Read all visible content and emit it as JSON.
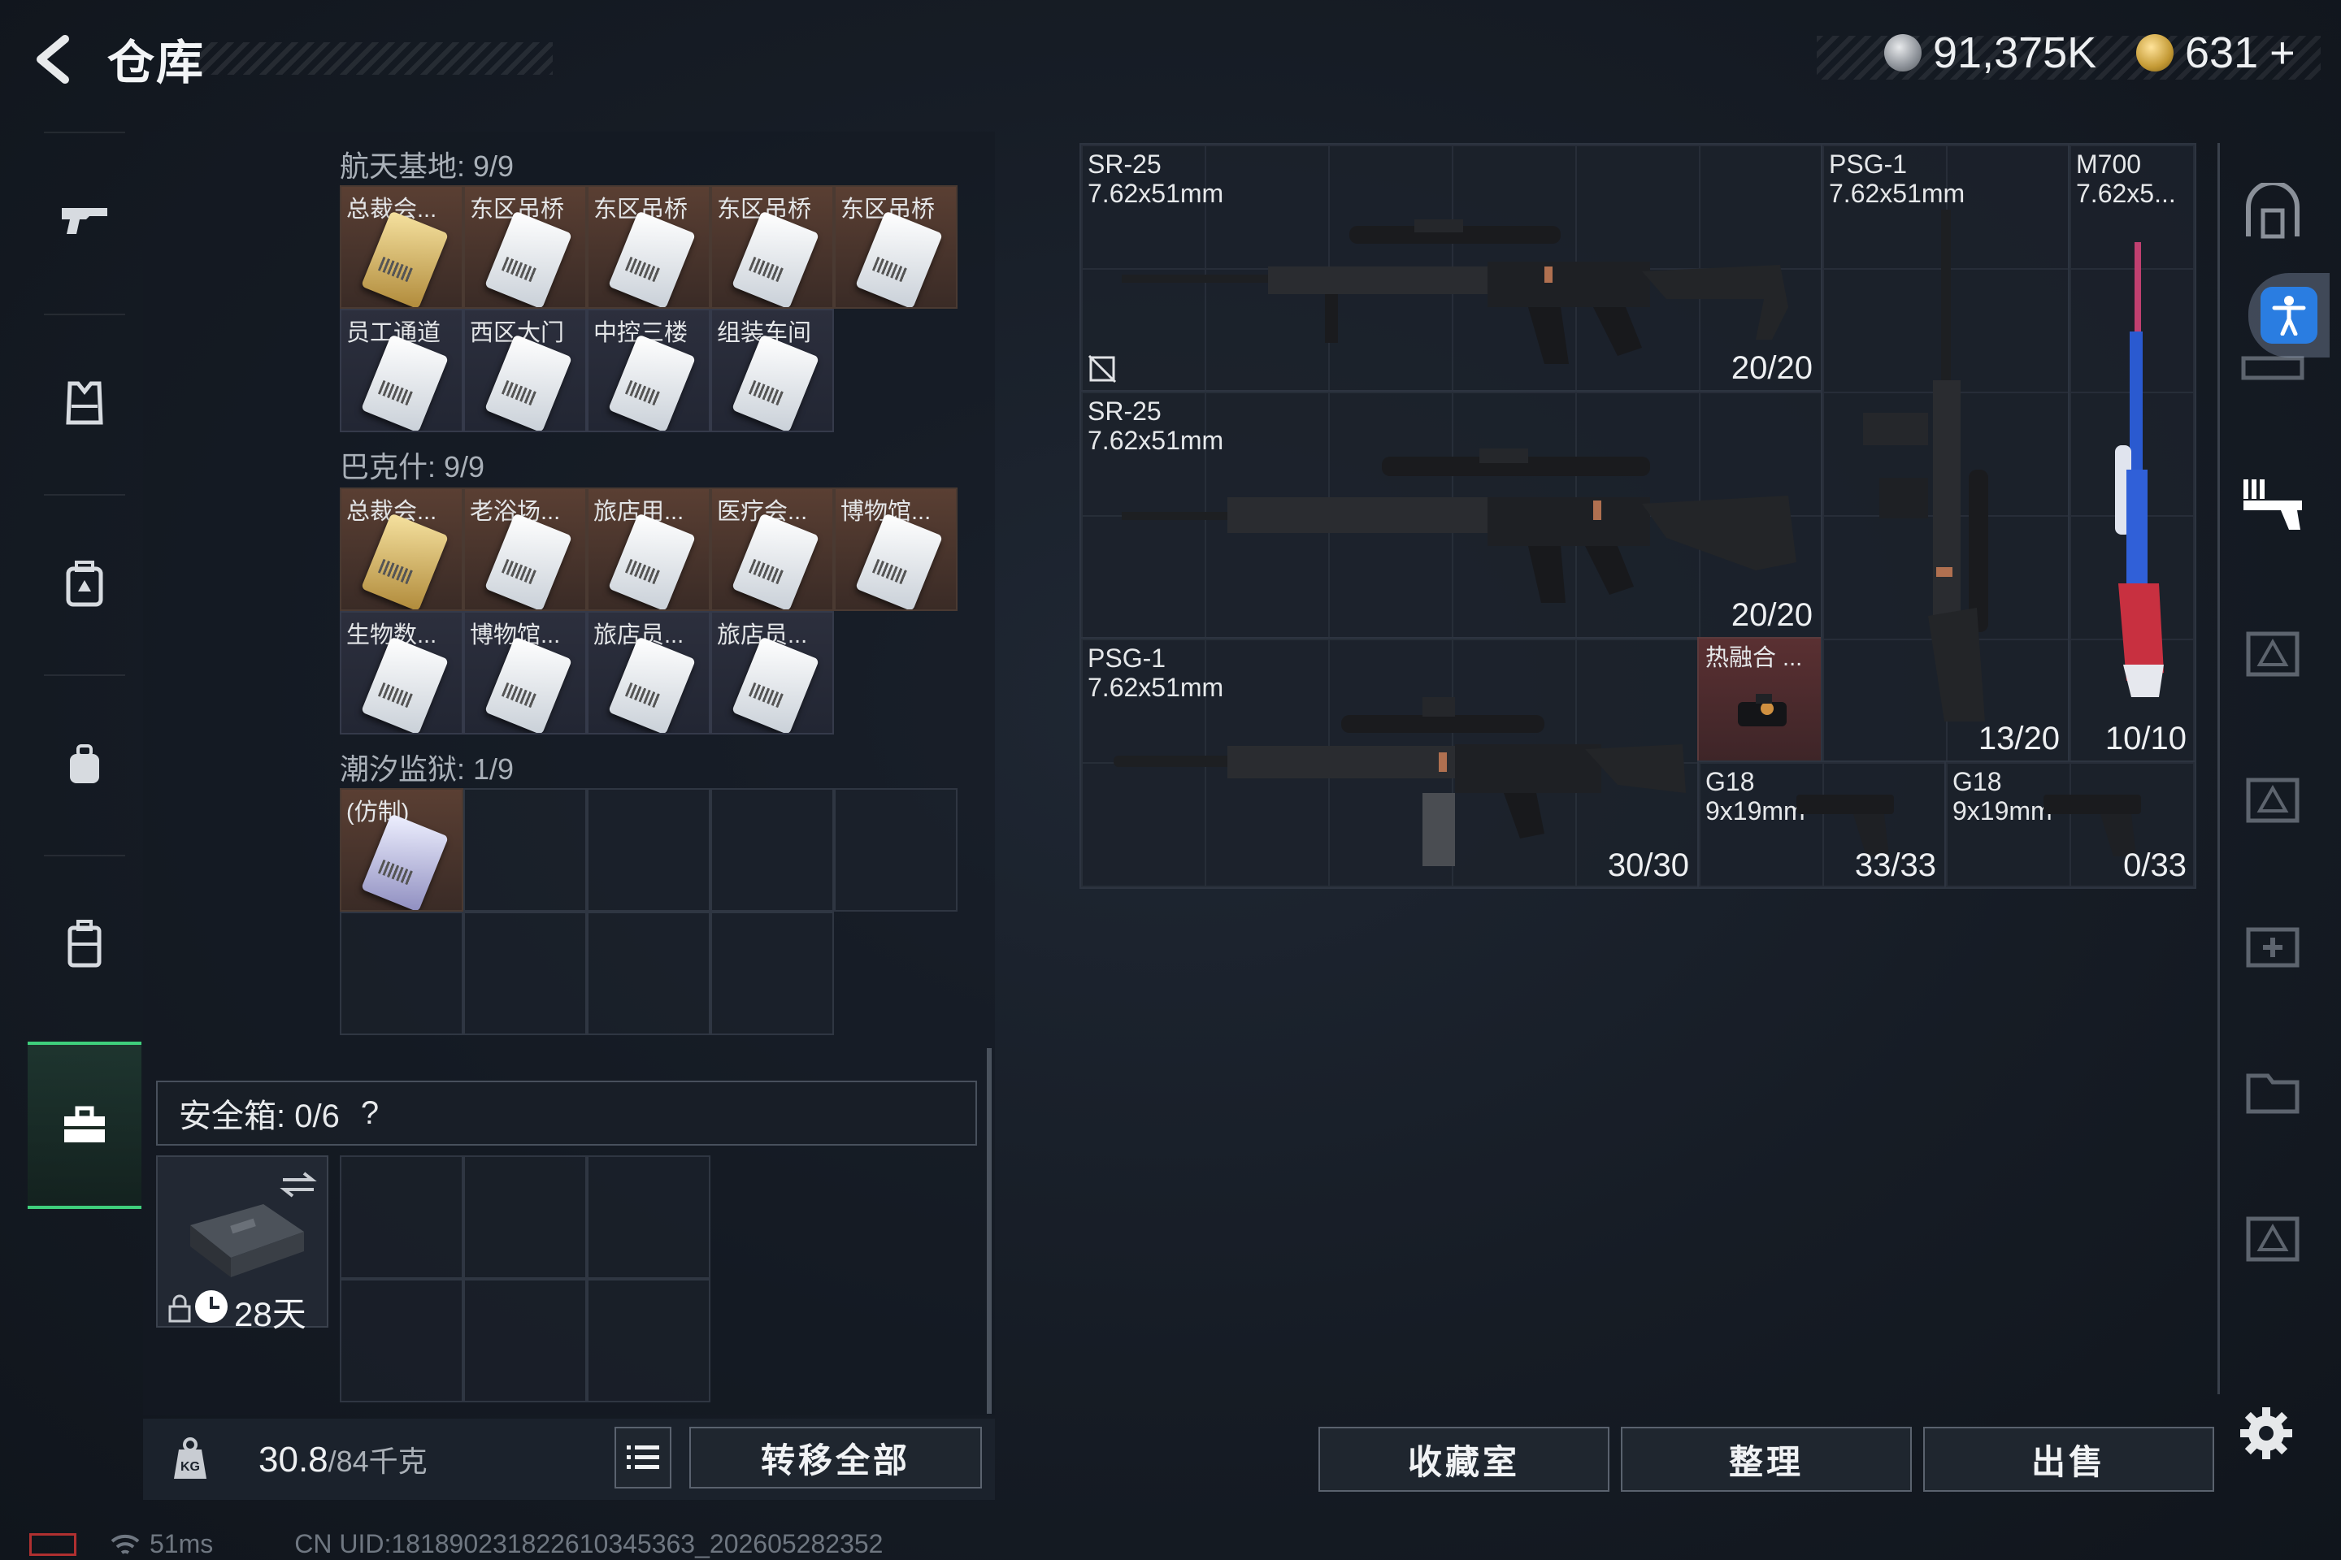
{
  "header": {
    "title": "仓库",
    "silver": "91,375K",
    "gold": "631",
    "gold_plus": "+"
  },
  "storage": {
    "sections": [
      {
        "label": "航天基地: 9/9",
        "cells": [
          {
            "label": "总裁会...",
            "style": "brown",
            "card": "gold"
          },
          {
            "label": "东区吊桥",
            "style": "brown",
            "card": "white"
          },
          {
            "label": "东区吊桥",
            "style": "brown",
            "card": "white"
          },
          {
            "label": "东区吊桥",
            "style": "brown",
            "card": "white"
          },
          {
            "label": "东区吊桥",
            "style": "brown",
            "card": "white"
          },
          {
            "label": "员工通道",
            "style": "dark",
            "card": "white"
          },
          {
            "label": "西区大门",
            "style": "dark",
            "card": "white"
          },
          {
            "label": "中控三楼",
            "style": "dark",
            "card": "white"
          },
          {
            "label": "组装车间",
            "style": "dark",
            "card": "white"
          }
        ]
      },
      {
        "label": "巴克什: 9/9",
        "cells": [
          {
            "label": "总裁会...",
            "style": "brown",
            "card": "gold"
          },
          {
            "label": "老浴场...",
            "style": "brown",
            "card": "white"
          },
          {
            "label": "旅店用...",
            "style": "brown",
            "card": "white"
          },
          {
            "label": "医疗会...",
            "style": "brown",
            "card": "white"
          },
          {
            "label": "博物馆...",
            "style": "brown",
            "card": "white"
          },
          {
            "label": "生物数...",
            "style": "dark",
            "card": "white"
          },
          {
            "label": "博物馆...",
            "style": "dark",
            "card": "white"
          },
          {
            "label": "旅店员...",
            "style": "dark",
            "card": "white"
          },
          {
            "label": "旅店员...",
            "style": "dark",
            "card": "white"
          }
        ]
      },
      {
        "label": "潮汐监狱: 1/9",
        "cells": [
          {
            "label": "(仿制)",
            "style": "brown",
            "card": "fake"
          }
        ]
      }
    ]
  },
  "safe": {
    "label": "安全箱: 0/6",
    "help": "?",
    "timer": "28天"
  },
  "bottom": {
    "weight_current": "30.8",
    "weight_max": "/84千克",
    "transfer_all": "转移全部",
    "collection": "收藏室",
    "sort": "整理",
    "sell": "出售"
  },
  "weapons": [
    {
      "name": "SR-25\n7.62x51mm",
      "count": "20/20"
    },
    {
      "name": "SR-25\n7.62x51mm",
      "count": "20/20"
    },
    {
      "name": "PSG-1\n7.62x51mm",
      "count": "30/30"
    },
    {
      "name": "热融合 ...",
      "count": ""
    },
    {
      "name": "PSG-1\n7.62x51mm",
      "count": "13/20"
    },
    {
      "name": "M700\n7.62x5...",
      "count": "10/10"
    },
    {
      "name": "G18\n9x19mm",
      "count": "33/33"
    },
    {
      "name": "G18\n9x19mm",
      "count": "0/33"
    }
  ],
  "status": {
    "ping": "51ms",
    "uid": "CN UID:18189023182261034536​3_202605282352"
  },
  "colors": {
    "accent": "#3fcf7c",
    "brown_cell": "#5a3f33",
    "dark_cell": "#2c2f3d",
    "accessibility": "#2a7de1"
  }
}
